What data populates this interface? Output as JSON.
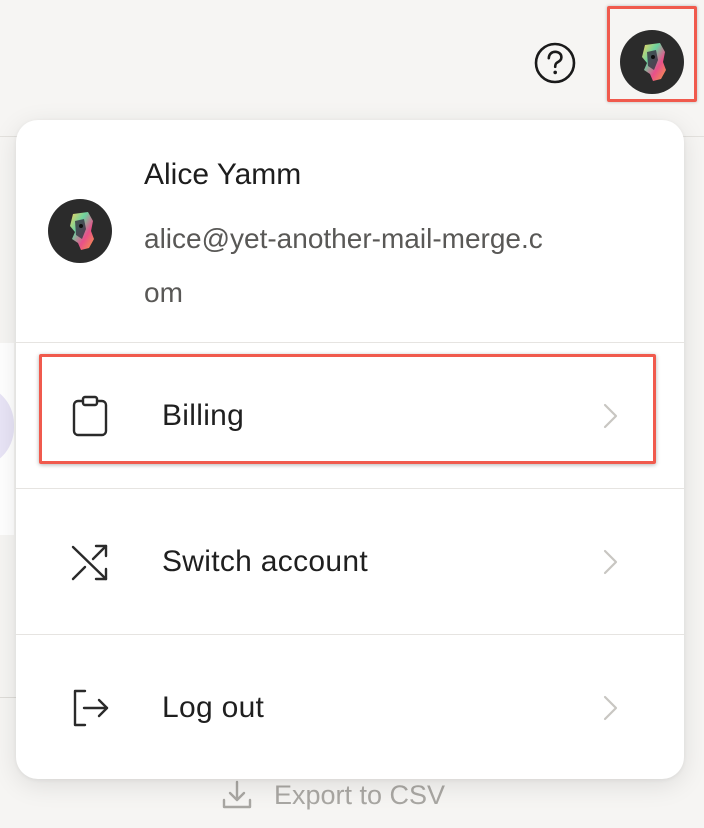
{
  "header": {
    "help_icon": "help-circle-icon",
    "avatar_icon": "user-avatar"
  },
  "profile": {
    "name": "Alice Yamm",
    "email": "alice@yet-another-mail-merge.com"
  },
  "menu": {
    "items": [
      {
        "label": "Billing",
        "icon": "clipboard-icon"
      },
      {
        "label": "Switch account",
        "icon": "shuffle-icon"
      },
      {
        "label": "Log out",
        "icon": "logout-icon"
      }
    ]
  },
  "background": {
    "export_label": "Export to CSV",
    "export_icon": "download-icon"
  },
  "colors": {
    "highlight": "#f05a4d",
    "text_primary": "#1f1f1f",
    "text_secondary": "#595856",
    "muted": "#a9a7a3",
    "avatar_bg": "#2b2b2b"
  }
}
